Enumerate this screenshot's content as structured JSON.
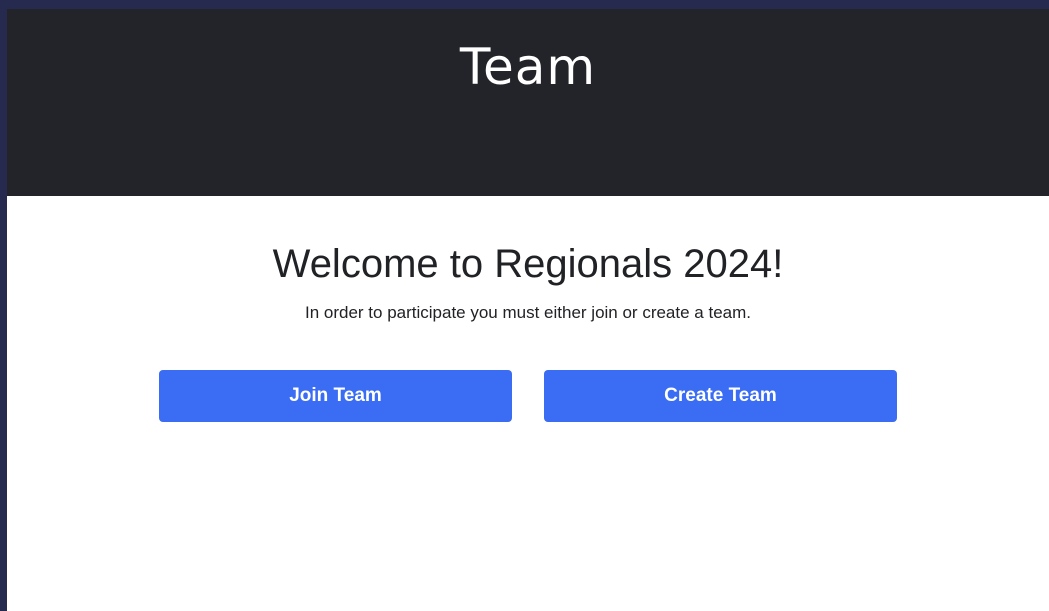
{
  "header": {
    "title": "Team"
  },
  "main": {
    "heading": "Welcome to Regionals 2024!",
    "subtext": "In order to participate you must either join or create a team.",
    "buttons": {
      "join_label": "Join Team",
      "create_label": "Create Team"
    }
  },
  "colors": {
    "page_border": "#262a4f",
    "header_background": "#222429",
    "button_primary": "#3a6cf4",
    "text_dark": "#212226"
  }
}
